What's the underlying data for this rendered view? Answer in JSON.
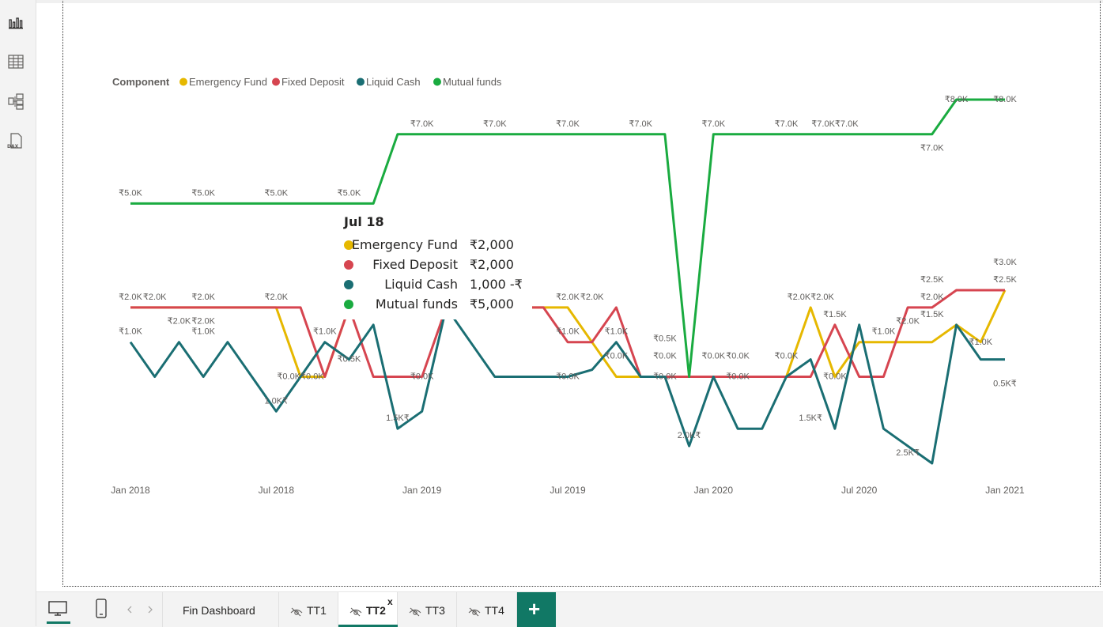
{
  "left_rail": {
    "items": [
      {
        "name": "report-view-icon",
        "active": true
      },
      {
        "name": "data-view-icon"
      },
      {
        "name": "model-view-icon"
      },
      {
        "name": "dax-query-view-icon",
        "label": "DAX"
      }
    ]
  },
  "legend": {
    "title": "Component",
    "items": [
      "Emergency Fund",
      "Fixed Deposit",
      "Liquid Cash",
      "Mutual funds"
    ]
  },
  "tooltip": {
    "title": "Jul 18",
    "rows": [
      {
        "name": "Emergency Fund",
        "value": "₹2,000",
        "color": "#E6B800"
      },
      {
        "name": "Fixed Deposit",
        "value": "₹2,000",
        "color": "#D64550"
      },
      {
        "name": "Liquid Cash",
        "value": "1,000 -₹",
        "color": "#1A6E73"
      },
      {
        "name": "Mutual funds",
        "value": "₹5,000",
        "color": "#1AAB40"
      }
    ]
  },
  "chart_data": {
    "type": "line",
    "x_axis": {
      "type": "date",
      "min": "2018-01",
      "max": "2021-01",
      "ticks": [
        "Jan 2018",
        "Jul 2018",
        "Jan 2019",
        "Jul 2019",
        "Jan 2020",
        "Jul 2020",
        "Jan 2021"
      ]
    },
    "y_range": [
      -2.5,
      8
    ],
    "x": [
      "2018-01",
      "2018-02",
      "2018-03",
      "2018-04",
      "2018-05",
      "2018-06",
      "2018-07",
      "2018-08",
      "2018-09",
      "2018-10",
      "2018-11",
      "2018-12",
      "2019-01",
      "2019-02",
      "2019-03",
      "2019-04",
      "2019-05",
      "2019-06",
      "2019-07",
      "2019-08",
      "2019-09",
      "2019-10",
      "2019-11",
      "2019-12",
      "2020-01",
      "2020-02",
      "2020-03",
      "2020-04",
      "2020-05",
      "2020-06",
      "2020-07",
      "2020-08",
      "2020-09",
      "2020-10",
      "2020-11",
      "2020-12",
      "2021-01"
    ],
    "series": [
      {
        "name": "Emergency Fund",
        "color": "#E6B800",
        "values": [
          2,
          2,
          2,
          2,
          2,
          2,
          2,
          0,
          0,
          2,
          2,
          2,
          2,
          2,
          2,
          2,
          2,
          2,
          2,
          2,
          1,
          0,
          0,
          0,
          0,
          0,
          0,
          0,
          0,
          0,
          2,
          0,
          1,
          1,
          1,
          1,
          1,
          1.5,
          1,
          2.5
        ],
        "labels": [
          "₹2.0K",
          "₹2.0K",
          "₹2.0K",
          "₹2.0K",
          "₹2.0K",
          "",
          "",
          "₹0.0K",
          "₹0.0K",
          "",
          "",
          "",
          "",
          "",
          "",
          "",
          "",
          "",
          "",
          "₹2.0K",
          "",
          "",
          "₹0.0K",
          "",
          "",
          "₹0.0K",
          "",
          "",
          "",
          "",
          "₹2.0K",
          "₹0.0K",
          "",
          "",
          "",
          "",
          "₹1.0K",
          "₹1.5K",
          "₹1.0K",
          "₹3.0K"
        ]
      },
      {
        "name": "Fixed Deposit",
        "color": "#D64550",
        "values": [
          2,
          2,
          2,
          2,
          2,
          2,
          2,
          2,
          0,
          2,
          0,
          0,
          0,
          2,
          2,
          2,
          2,
          2,
          2,
          1,
          1,
          1,
          2,
          0,
          0,
          0,
          0,
          0,
          0,
          0,
          0,
          0,
          2,
          0,
          0,
          2,
          2,
          2.5,
          2.5,
          2.5
        ],
        "labels": [
          "",
          "₹2.0K",
          "₹2.0K",
          "₹2.0K",
          "",
          "",
          "",
          "",
          "₹0.0K",
          "",
          "",
          "",
          "₹0.0K",
          "",
          "",
          "",
          "",
          "",
          "",
          "₹1.0K",
          "",
          "",
          "₹2.0K",
          "₹0.0K",
          "",
          "",
          "",
          "",
          "₹0.0K",
          "",
          "",
          "₹0.0K",
          "₹1.5K",
          "",
          "",
          "₹2.0K",
          "",
          "₹2.5K",
          "",
          "₹2.5K"
        ]
      }
    ],
    "series_visible": [
      {
        "name": "Emergency Fund",
        "color": "#E6B800",
        "points": [
          [
            "2018-01",
            2
          ],
          [
            "2018-07",
            2
          ],
          [
            "2018-08",
            0
          ],
          [
            "2018-09",
            0
          ],
          [
            "2018-10",
            2
          ],
          [
            "2019-06",
            2
          ],
          [
            "2019-07",
            2
          ],
          [
            "2019-08",
            1
          ],
          [
            "2019-09",
            0
          ],
          [
            "2019-10",
            0
          ],
          [
            "2020-03",
            0
          ],
          [
            "2020-04",
            0
          ],
          [
            "2020-05",
            2
          ],
          [
            "2020-06",
            0
          ],
          [
            "2020-07",
            1
          ],
          [
            "2020-10",
            1
          ],
          [
            "2020-11",
            1.5
          ],
          [
            "2020-12",
            1
          ],
          [
            "2021-01",
            2.5
          ]
        ]
      },
      {
        "name": "Fixed Deposit",
        "color": "#D64550",
        "points": [
          [
            "2018-01",
            2
          ],
          [
            "2018-07",
            2
          ],
          [
            "2018-08",
            2
          ],
          [
            "2018-09",
            0
          ],
          [
            "2018-10",
            2
          ],
          [
            "2018-11",
            0
          ],
          [
            "2019-01",
            0
          ],
          [
            "2019-02",
            2
          ],
          [
            "2019-06",
            2
          ],
          [
            "2019-07",
            1
          ],
          [
            "2019-08",
            1
          ],
          [
            "2019-09",
            2
          ],
          [
            "2019-10",
            0
          ],
          [
            "2020-05",
            0
          ],
          [
            "2020-06",
            1.5
          ],
          [
            "2020-07",
            0
          ],
          [
            "2020-08",
            0
          ],
          [
            "2020-09",
            2
          ],
          [
            "2020-10",
            2
          ],
          [
            "2020-11",
            2.5
          ],
          [
            "2021-01",
            2.5
          ]
        ]
      },
      {
        "name": "Liquid Cash",
        "color": "#1A6E73",
        "points": [
          [
            "2018-01",
            1
          ],
          [
            "2018-02",
            0
          ],
          [
            "2018-03",
            1
          ],
          [
            "2018-04",
            0
          ],
          [
            "2018-05",
            1
          ],
          [
            "2018-06",
            0
          ],
          [
            "2018-07",
            -1
          ],
          [
            "2018-08",
            0
          ],
          [
            "2018-09",
            1
          ],
          [
            "2018-10",
            0.5
          ],
          [
            "2018-11",
            1.5
          ],
          [
            "2018-12",
            -1.5
          ],
          [
            "2019-01",
            -1
          ],
          [
            "2019-02",
            2
          ],
          [
            "2019-03",
            1
          ],
          [
            "2019-04",
            0
          ],
          [
            "2019-05",
            0
          ],
          [
            "2019-06",
            0
          ],
          [
            "2019-07",
            0
          ],
          [
            "2019-08",
            0.2
          ],
          [
            "2019-09",
            1
          ],
          [
            "2019-10",
            0
          ],
          [
            "2019-11",
            0
          ],
          [
            "2019-12",
            -2
          ],
          [
            "2020-01",
            0
          ],
          [
            "2020-02",
            -1.5
          ],
          [
            "2020-03",
            -1.5
          ],
          [
            "2020-04",
            0
          ],
          [
            "2020-05",
            0.5
          ],
          [
            "2020-06",
            -1.5
          ],
          [
            "2020-07",
            1.5
          ],
          [
            "2020-08",
            -1.5
          ],
          [
            "2020-09",
            -2
          ],
          [
            "2020-10",
            -2.5
          ],
          [
            "2020-11",
            1.5
          ],
          [
            "2020-12",
            0.5
          ],
          [
            "2021-01",
            0.5
          ]
        ]
      },
      {
        "name": "Mutual funds",
        "color": "#1AAB40",
        "points": [
          [
            "2018-01",
            5
          ],
          [
            "2018-02",
            5
          ],
          [
            "2018-03",
            5
          ],
          [
            "2018-04",
            5
          ],
          [
            "2018-05",
            5
          ],
          [
            "2018-06",
            5
          ],
          [
            "2018-07",
            5
          ],
          [
            "2018-08",
            5
          ],
          [
            "2018-09",
            5
          ],
          [
            "2018-10",
            5
          ],
          [
            "2018-11",
            5
          ],
          [
            "2018-12",
            7
          ],
          [
            "2019-01",
            7
          ],
          [
            "2019-02",
            7
          ],
          [
            "2019-03",
            7
          ],
          [
            "2019-04",
            7
          ],
          [
            "2019-05",
            7
          ],
          [
            "2019-06",
            7
          ],
          [
            "2019-07",
            7
          ],
          [
            "2019-08",
            7
          ],
          [
            "2019-09",
            7
          ],
          [
            "2019-10",
            7
          ],
          [
            "2019-11",
            7
          ],
          [
            "2019-12",
            0
          ],
          [
            "2020-01",
            7
          ],
          [
            "2020-02",
            7
          ],
          [
            "2020-03",
            7
          ],
          [
            "2020-04",
            7
          ],
          [
            "2020-05",
            7
          ],
          [
            "2020-06",
            7
          ],
          [
            "2020-07",
            7
          ],
          [
            "2020-08",
            7
          ],
          [
            "2020-09",
            7
          ],
          [
            "2020-10",
            7
          ],
          [
            "2020-11",
            8
          ],
          [
            "2020-12",
            8
          ],
          [
            "2021-01",
            8
          ]
        ]
      }
    ],
    "data_labels": [
      {
        "date": "2018-01",
        "y": 5,
        "text": "₹5.0K"
      },
      {
        "date": "2018-04",
        "y": 5,
        "text": "₹5.0K"
      },
      {
        "date": "2018-07",
        "y": 5,
        "text": "₹5.0K"
      },
      {
        "date": "2018-10",
        "y": 5,
        "text": "₹5.0K"
      },
      {
        "date": "2019-01",
        "y": 7,
        "text": "₹7.0K"
      },
      {
        "date": "2019-04",
        "y": 7,
        "text": "₹7.0K"
      },
      {
        "date": "2019-07",
        "y": 7,
        "text": "₹7.0K"
      },
      {
        "date": "2019-10",
        "y": 7,
        "text": "₹7.0K"
      },
      {
        "date": "2020-01",
        "y": 7,
        "text": "₹7.0K"
      },
      {
        "date": "2020-04",
        "y": 7,
        "text": "₹7.0K"
      },
      {
        "date": "2020-06",
        "y": 7,
        "text": "₹7.0K₹7.0K"
      },
      {
        "date": "2020-10",
        "y": 6.3,
        "text": "₹7.0K"
      },
      {
        "date": "2020-11",
        "y": 7.7,
        "text": "₹8.0K"
      },
      {
        "date": "2021-01",
        "y": 7.7,
        "text": "₹8.0K"
      },
      {
        "date": "2018-01",
        "y": 2,
        "text": "₹2.0K"
      },
      {
        "date": "2018-02",
        "y": 2,
        "text": "₹2.0K"
      },
      {
        "date": "2018-04",
        "y": 2,
        "text": "₹2.0K"
      },
      {
        "date": "2018-07",
        "y": 2,
        "text": "₹2.0K"
      },
      {
        "date": "2018-03",
        "y": 1.3,
        "text": "₹2.0K"
      },
      {
        "date": "2018-04",
        "y": 1.3,
        "text": "₹2.0K"
      },
      {
        "date": "2018-01",
        "y": 1,
        "text": "₹1.0K"
      },
      {
        "date": "2018-04",
        "y": 1,
        "text": "₹1.0K"
      },
      {
        "date": "2018-09",
        "y": 1,
        "text": "₹1.0K"
      },
      {
        "date": "2018-07",
        "y": -1,
        "text": "1.0K₹"
      },
      {
        "date": "2018-08",
        "y": -0.3,
        "text": "₹0.0K₹0.0K"
      },
      {
        "date": "2018-10",
        "y": 0.2,
        "text": "₹0.5K"
      },
      {
        "date": "2018-12",
        "y": -1.5,
        "text": "1.5K₹"
      },
      {
        "date": "2019-01",
        "y": -0.3,
        "text": "₹0.0K"
      },
      {
        "date": "2019-03",
        "y": 2,
        "text": "₹0.0K"
      },
      {
        "date": "2019-07",
        "y": 2,
        "text": "₹2.0K"
      },
      {
        "date": "2019-08",
        "y": 2,
        "text": "₹2.0K"
      },
      {
        "date": "2019-07",
        "y": 1,
        "text": "₹1.0K"
      },
      {
        "date": "2019-09",
        "y": 1,
        "text": "₹1.0K"
      },
      {
        "date": "2019-07",
        "y": -0.3,
        "text": "₹0.0K"
      },
      {
        "date": "2019-09",
        "y": 0.3,
        "text": "₹0.0K"
      },
      {
        "date": "2019-11",
        "y": 0.8,
        "text": "₹0.5K"
      },
      {
        "date": "2019-11",
        "y": 0.3,
        "text": "₹0.0K"
      },
      {
        "date": "2019-11",
        "y": -0.3,
        "text": "₹0.0K"
      },
      {
        "date": "2019-12",
        "y": -2,
        "text": "2.0K₹"
      },
      {
        "date": "2020-01",
        "y": 0.3,
        "text": "₹0.0K"
      },
      {
        "date": "2020-02",
        "y": 0.3,
        "text": "₹0.0K"
      },
      {
        "date": "2020-02",
        "y": -0.3,
        "text": "₹0.0K"
      },
      {
        "date": "2020-04",
        "y": 0.3,
        "text": "₹0.0K"
      },
      {
        "date": "2020-05",
        "y": 2,
        "text": "₹2.0K₹2.0K"
      },
      {
        "date": "2020-06",
        "y": 1.5,
        "text": "₹1.5K"
      },
      {
        "date": "2020-06",
        "y": -0.3,
        "text": "₹0.0K"
      },
      {
        "date": "2020-05",
        "y": -1.5,
        "text": "1.5K₹"
      },
      {
        "date": "2020-08",
        "y": 1,
        "text": "₹1.0K"
      },
      {
        "date": "2020-09",
        "y": 1.3,
        "text": "₹2.0K"
      },
      {
        "date": "2020-10",
        "y": 2.5,
        "text": "₹2.5K"
      },
      {
        "date": "2020-10",
        "y": 2,
        "text": "₹2.0K"
      },
      {
        "date": "2020-10",
        "y": 1.5,
        "text": "₹1.5K"
      },
      {
        "date": "2020-12",
        "y": 0.7,
        "text": "₹1.0K"
      },
      {
        "date": "2021-01",
        "y": 3,
        "text": "₹3.0K"
      },
      {
        "date": "2021-01",
        "y": 2.5,
        "text": "₹2.5K"
      },
      {
        "date": "2020-09",
        "y": -2.5,
        "text": "2.5K₹"
      },
      {
        "date": "2021-01",
        "y": -0.5,
        "text": "0.5K₹"
      }
    ]
  },
  "tabbar": {
    "pages": [
      {
        "label": "Fin Dashboard",
        "hidden": false
      },
      {
        "label": "TT1",
        "hidden": true
      },
      {
        "label": "TT2",
        "hidden": true,
        "active": true,
        "close": "x"
      },
      {
        "label": "TT3",
        "hidden": true
      },
      {
        "label": "TT4",
        "hidden": true
      }
    ],
    "add_label": "+",
    "accent": "#117865"
  }
}
